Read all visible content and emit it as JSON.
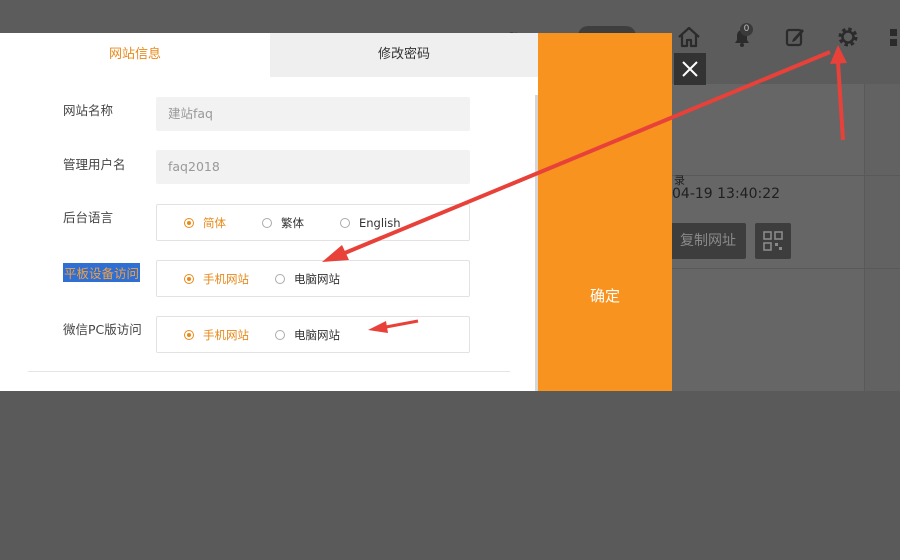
{
  "background": {
    "header_icons": [
      "home-icon",
      "bell-icon",
      "edit-icon",
      "gear-icon",
      "menu-icon"
    ],
    "notification_count": "0",
    "login_label": "录",
    "login_time": "04-19 13:40:22",
    "copy_url_label": "复制网址"
  },
  "dialog": {
    "tabs": [
      "网站信息",
      "修改密码"
    ],
    "site_name": {
      "label": "网站名称",
      "value": "建站faq"
    },
    "admin_name": {
      "label": "管理用户名",
      "value": "faq2018"
    },
    "language": {
      "label": "后台语言",
      "options": [
        "简体",
        "繁体",
        "English"
      ],
      "selected": "简体"
    },
    "tablet_access": {
      "label": "平板设备访问",
      "options": [
        "手机网站",
        "电脑网站"
      ],
      "selected": "手机网站"
    },
    "wechat_pc_access": {
      "label": "微信PC版访问",
      "options": [
        "手机网站",
        "电脑网站"
      ],
      "selected": "手机网站"
    },
    "confirm_label": "确定"
  },
  "colors": {
    "accent": "#f7931e",
    "highlight": "#2f6fd4",
    "arrow": "#e8413a"
  }
}
